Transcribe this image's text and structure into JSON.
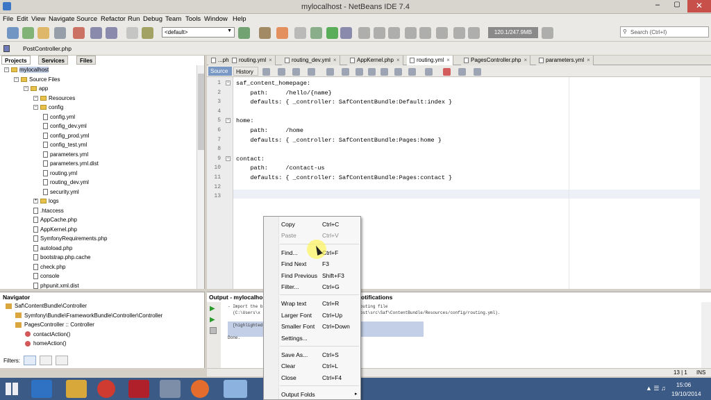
{
  "window": {
    "title": "mylocalhost - NetBeans IDE 7.4"
  },
  "menu": [
    "File",
    "Edit",
    "View",
    "Navigate",
    "Source",
    "Refactor",
    "Run",
    "Debug",
    "Team",
    "Tools",
    "Window",
    "Help"
  ],
  "toolbar": {
    "config_select": "<default>",
    "memory": "120.1/247.9MB"
  },
  "search": {
    "placeholder": "Search (Ctrl+I)"
  },
  "path": {
    "file": "PostController.php"
  },
  "project_tabs": [
    "Projects",
    "Services",
    "Files"
  ],
  "tree": [
    {
      "label": "mylocalhost",
      "indent": 0,
      "kind": "project"
    },
    {
      "label": "Source Files",
      "indent": 1,
      "kind": "folder"
    },
    {
      "label": "app",
      "indent": 2,
      "kind": "folder"
    },
    {
      "label": "Resources",
      "indent": 3,
      "kind": "folder"
    },
    {
      "label": "config",
      "indent": 3,
      "kind": "folder"
    },
    {
      "label": "config.yml",
      "indent": 4,
      "kind": "file"
    },
    {
      "label": "config_dev.yml",
      "indent": 4,
      "kind": "file"
    },
    {
      "label": "config_prod.yml",
      "indent": 4,
      "kind": "file"
    },
    {
      "label": "config_test.yml",
      "indent": 4,
      "kind": "file"
    },
    {
      "label": "parameters.yml",
      "indent": 4,
      "kind": "file"
    },
    {
      "label": "parameters.yml.dist",
      "indent": 4,
      "kind": "file"
    },
    {
      "label": "routing.yml",
      "indent": 4,
      "kind": "file"
    },
    {
      "label": "routing_dev.yml",
      "indent": 4,
      "kind": "file"
    },
    {
      "label": "security.yml",
      "indent": 4,
      "kind": "file"
    },
    {
      "label": "logs",
      "indent": 3,
      "kind": "folder"
    },
    {
      "label": ".htaccess",
      "indent": 3,
      "kind": "file"
    },
    {
      "label": "AppCache.php",
      "indent": 3,
      "kind": "file"
    },
    {
      "label": "AppKernel.php",
      "indent": 3,
      "kind": "file"
    },
    {
      "label": "SymfonyRequirements.php",
      "indent": 3,
      "kind": "file"
    },
    {
      "label": "autoload.php",
      "indent": 3,
      "kind": "file"
    },
    {
      "label": "bootstrap.php.cache",
      "indent": 3,
      "kind": "file"
    },
    {
      "label": "check.php",
      "indent": 3,
      "kind": "file"
    },
    {
      "label": "console",
      "indent": 3,
      "kind": "file"
    },
    {
      "label": "phpunit.xml.dist",
      "indent": 3,
      "kind": "file"
    }
  ],
  "navigator": {
    "title": "Navigator",
    "items": [
      {
        "label": "Saf\\ContentBundle\\Controller",
        "indent": 0
      },
      {
        "label": "Symfony\\Bundle\\FrameworkBundle\\Controller\\Controller",
        "indent": 1
      },
      {
        "label": "PagesController :: Controller",
        "indent": 1
      },
      {
        "label": "contactAction()",
        "indent": 2
      },
      {
        "label": "homeAction()",
        "indent": 2
      }
    ],
    "filters_label": "Filters:"
  },
  "editor_tabs": [
    "...php",
    "routing.yml",
    "routing_dev.yml",
    "AppKernel.php",
    "routing.yml",
    "PagesController.php",
    "parameters.yml"
  ],
  "editor_modes": {
    "source": "Source",
    "history": "History"
  },
  "code_lines": [
    "saf_content_homepage:",
    "    path:     /hello/{name}",
    "    defaults: { _controller: SafContentBundle:Default:index }",
    "",
    "home:",
    "    path:     /home",
    "    defaults: { _controller: SafContentBundle:Pages:home }",
    "",
    "contact:",
    "    path:     /contact-us",
    "    defaults: { _controller: SafContentBundle:Pages:contact }",
    "",
    ""
  ],
  "line_numbers": [
    "1",
    "2",
    "3",
    "4",
    "5",
    "6",
    "7",
    "8",
    "9",
    "10",
    "11",
    "12",
    "13"
  ],
  "output": {
    "title": "Output - mylocalhost",
    "right_title": "otifications",
    "lines": [
      "- Import the b                                    e routing file",
      "  (C:\\Users\\x                                    calhost\\src\\Saf\\ContentBundle/Resources/config/routing.yml).",
      "",
      "  [highlighted output]",
      "",
      "Done."
    ]
  },
  "status": {
    "position": "13 | 1",
    "mode": "INS"
  },
  "context_menu": [
    {
      "label": "Copy",
      "key": "Ctrl+C",
      "enabled": true
    },
    {
      "label": "Paste",
      "key": "Ctrl+V",
      "enabled": false
    },
    {
      "sep": true
    },
    {
      "label": "Find...",
      "key": "Ctrl+F",
      "enabled": true
    },
    {
      "label": "Find Next",
      "key": "F3",
      "enabled": true
    },
    {
      "label": "Find Previous",
      "key": "Shift+F3",
      "enabled": true
    },
    {
      "label": "Filter...",
      "key": "Ctrl+G",
      "enabled": true
    },
    {
      "sep": true
    },
    {
      "label": "Wrap text",
      "key": "Ctrl+R",
      "enabled": true
    },
    {
      "label": "Larger Font",
      "key": "Ctrl+Up",
      "enabled": true
    },
    {
      "label": "Smaller Font",
      "key": "Ctrl+Down",
      "enabled": true
    },
    {
      "label": "Settings...",
      "key": "",
      "enabled": true
    },
    {
      "sep": true
    },
    {
      "label": "Save As...",
      "key": "Ctrl+S",
      "enabled": true
    },
    {
      "label": "Clear",
      "key": "Ctrl+L",
      "enabled": true
    },
    {
      "label": "Close",
      "key": "Ctrl+F4",
      "enabled": true
    },
    {
      "sep": true
    },
    {
      "label": "Output Folds",
      "key": "",
      "enabled": true,
      "submenu": true
    }
  ],
  "taskbar": {
    "time": "15:06",
    "date": "19/10/2014"
  },
  "colors": {
    "keyword": "#1a1aa6",
    "accent": "#3c5a86",
    "selection": "#c2cfe6"
  }
}
